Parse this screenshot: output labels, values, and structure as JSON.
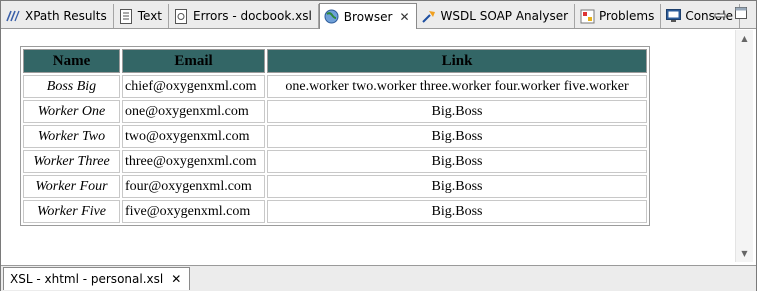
{
  "tabs": [
    {
      "label": "XPath Results",
      "icon": "xpath-icon"
    },
    {
      "label": "Text",
      "icon": "text-doc-icon"
    },
    {
      "label": "Errors - docbook.xsl",
      "icon": "errors-icon"
    },
    {
      "label": "Browser",
      "icon": "globe-icon"
    },
    {
      "label": "WSDL SOAP Analyser",
      "icon": "wsdl-icon"
    },
    {
      "label": "Problems",
      "icon": "problems-icon"
    },
    {
      "label": "Console",
      "icon": "console-icon"
    }
  ],
  "table": {
    "headers": [
      "Name",
      "Email",
      "Link"
    ],
    "rows": [
      {
        "name": "Boss Big",
        "email": "chief@oxygenxml.com",
        "link": "one.worker two.worker three.worker four.worker five.worker"
      },
      {
        "name": "Worker One",
        "email": "one@oxygenxml.com",
        "link": "Big.Boss"
      },
      {
        "name": "Worker Two",
        "email": "two@oxygenxml.com",
        "link": "Big.Boss"
      },
      {
        "name": "Worker Three",
        "email": "three@oxygenxml.com",
        "link": "Big.Boss"
      },
      {
        "name": "Worker Four",
        "email": "four@oxygenxml.com",
        "link": "Big.Boss"
      },
      {
        "name": "Worker Five",
        "email": "five@oxygenxml.com",
        "link": "Big.Boss"
      }
    ]
  },
  "bottom_tab": {
    "label": "XSL - xhtml - personal.xsl"
  },
  "colors": {
    "header_bg": "#336666"
  }
}
